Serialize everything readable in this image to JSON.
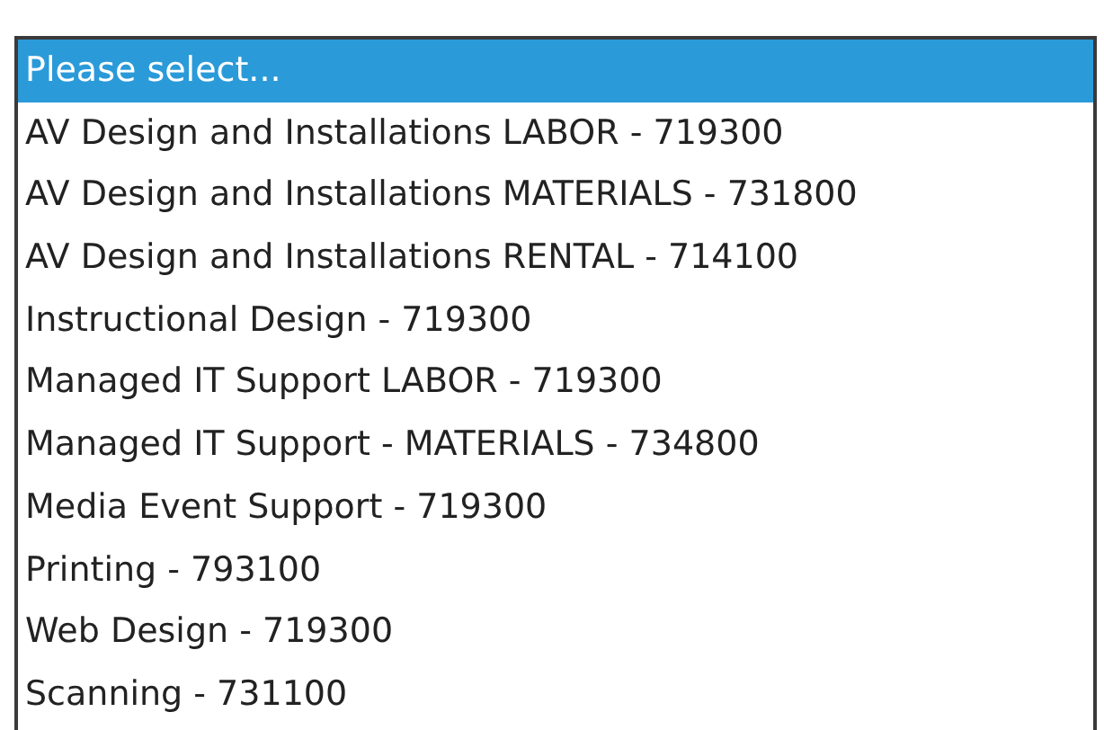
{
  "dropdown": {
    "options": [
      {
        "label": "Please select...",
        "selected": true
      },
      {
        "label": "AV Design and Installations LABOR - 719300",
        "selected": false
      },
      {
        "label": "AV Design and Installations MATERIALS - 731800",
        "selected": false
      },
      {
        "label": "AV Design and Installations RENTAL - 714100",
        "selected": false
      },
      {
        "label": "Instructional Design - 719300",
        "selected": false
      },
      {
        "label": "Managed IT Support LABOR - 719300",
        "selected": false
      },
      {
        "label": "Managed IT Support - MATERIALS - 734800",
        "selected": false
      },
      {
        "label": "Media Event Support - 719300",
        "selected": false
      },
      {
        "label": "Printing - 793100",
        "selected": false
      },
      {
        "label": "Web Design - 719300",
        "selected": false
      },
      {
        "label": "Scanning - 731100",
        "selected": false
      }
    ]
  }
}
